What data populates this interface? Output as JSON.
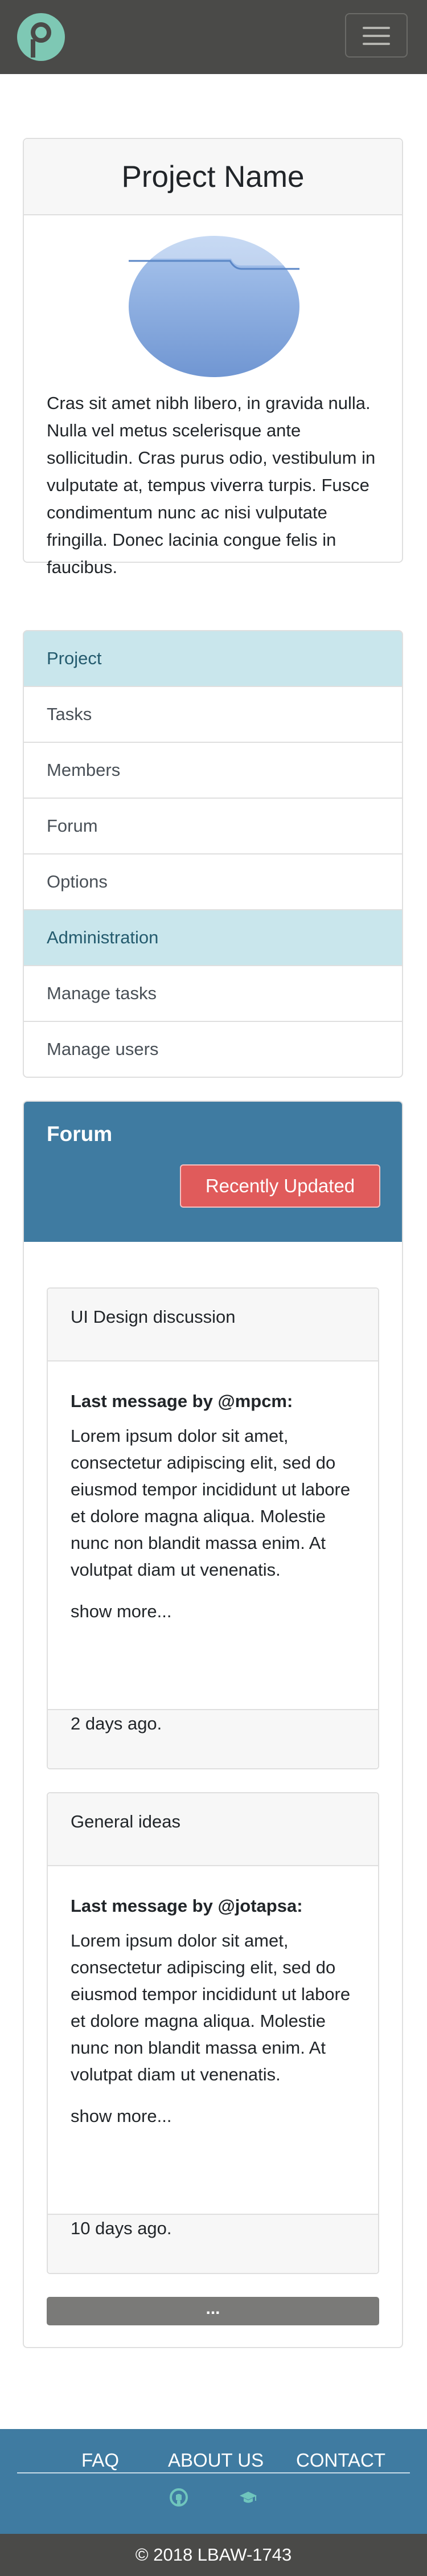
{
  "navbar": {
    "logo_alt": "p-logo",
    "toggle_icon": "hamburger-icon"
  },
  "project": {
    "name": "Project Name",
    "description": "Cras sit amet nibh libero, in gravida nulla. Nulla vel metus scelerisque ante sollicitudin. Cras purus odio, vestibulum in vulputate at, tempus viverra turpis. Fusce condimentum nunc ac nisi vulputate fringilla. Donec lacinia congue felis in faucibus."
  },
  "menu": {
    "project_header": "Project",
    "project_items": [
      "Tasks",
      "Members",
      "Forum",
      "Options"
    ],
    "admin_header": "Administration",
    "admin_items": [
      "Manage tasks",
      "Manage users"
    ]
  },
  "forum": {
    "title": "Forum",
    "sort_button": "Recently Updated",
    "posts": [
      {
        "title": "UI Design discussion",
        "author": "Last message by @mpcm:",
        "body": "Lorem ipsum dolor sit amet, consectetur adipiscing elit, sed do eiusmod tempor incididunt ut labore et dolore magna aliqua. Molestie nunc non blandit massa enim. At volutpat diam ut venenatis.",
        "more": "show more...",
        "time": "2 days ago."
      },
      {
        "title": "General ideas",
        "author": "Last message by @jotapsa:",
        "body": "Lorem ipsum dolor sit amet, consectetur adipiscing elit, sed do eiusmod tempor incididunt ut labore et dolore magna aliqua. Molestie nunc non blandit massa enim. At volutpat diam ut venenatis.",
        "more": "show more...",
        "time": "10 days ago."
      }
    ],
    "load_more": "..."
  },
  "footer": {
    "links": [
      "FAQ",
      "ABOUT US",
      "CONTACT"
    ],
    "icons": [
      "github-icon",
      "graduation-cap-icon"
    ],
    "copyright": "© 2018 LBAW-1743"
  },
  "colors": {
    "navbar": "#4a4a48",
    "accent": "#3f7ba1",
    "logo": "#7ec8b4",
    "danger": "#e05b5b",
    "active_item": "#c9e6ec"
  }
}
